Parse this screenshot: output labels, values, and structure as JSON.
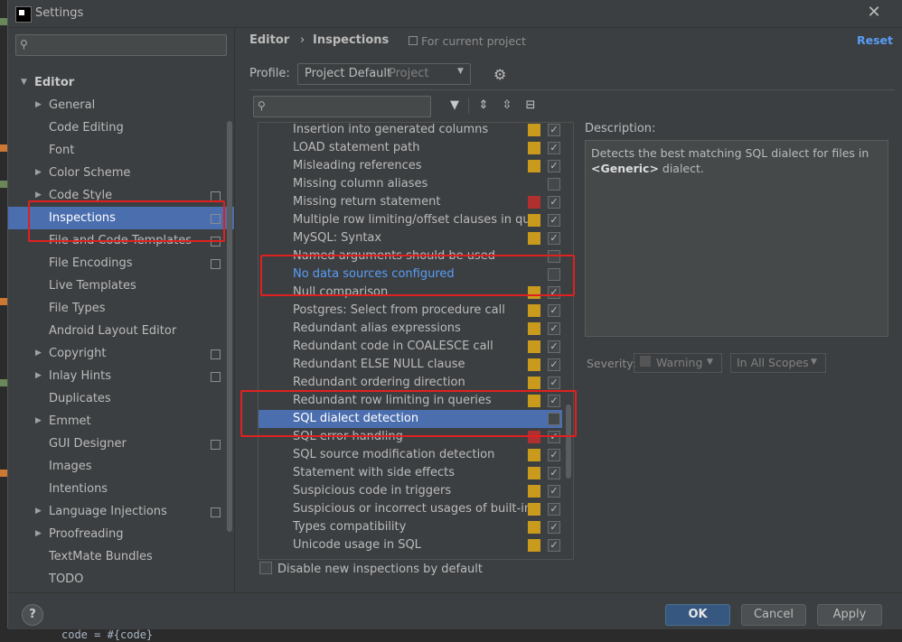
{
  "window": {
    "title": "Settings"
  },
  "left_tree": {
    "items": [
      {
        "label": "Editor",
        "arrow": "▼",
        "root": true
      },
      {
        "label": "General",
        "arrow": "▶"
      },
      {
        "label": "Code Editing",
        "arrow": ""
      },
      {
        "label": "Font",
        "arrow": ""
      },
      {
        "label": "Color Scheme",
        "arrow": "▶"
      },
      {
        "label": "Code Style",
        "arrow": "▶",
        "copy": true
      },
      {
        "label": "Inspections",
        "arrow": "",
        "copy": true,
        "selected": true
      },
      {
        "label": "File and Code Templates",
        "arrow": "",
        "copy": true
      },
      {
        "label": "File Encodings",
        "arrow": "",
        "copy": true
      },
      {
        "label": "Live Templates",
        "arrow": ""
      },
      {
        "label": "File Types",
        "arrow": ""
      },
      {
        "label": "Android Layout Editor",
        "arrow": ""
      },
      {
        "label": "Copyright",
        "arrow": "▶",
        "copy": true
      },
      {
        "label": "Inlay Hints",
        "arrow": "▶",
        "copy": true
      },
      {
        "label": "Duplicates",
        "arrow": ""
      },
      {
        "label": "Emmet",
        "arrow": "▶"
      },
      {
        "label": "GUI Designer",
        "arrow": "",
        "copy": true
      },
      {
        "label": "Images",
        "arrow": ""
      },
      {
        "label": "Intentions",
        "arrow": ""
      },
      {
        "label": "Language Injections",
        "arrow": "▶",
        "copy": true
      },
      {
        "label": "Proofreading",
        "arrow": "▶"
      },
      {
        "label": "TextMate Bundles",
        "arrow": ""
      },
      {
        "label": "TODO",
        "arrow": ""
      }
    ]
  },
  "breadcrumb": {
    "parent": "Editor",
    "current": "Inspections",
    "scope_note": "For current project",
    "reset_label": "Reset"
  },
  "profile": {
    "label": "Profile:",
    "value": "Project Default",
    "scope": "Project"
  },
  "inspections": [
    {
      "name": "Insertion into generated columns",
      "severity": "#c99a1c",
      "checked": true
    },
    {
      "name": "LOAD statement path",
      "severity": "#c99a1c",
      "checked": true
    },
    {
      "name": "Misleading references",
      "severity": "#c99a1c",
      "checked": true
    },
    {
      "name": "Missing column aliases",
      "severity": "",
      "checked": false
    },
    {
      "name": "Missing return statement",
      "severity": "#b03030",
      "checked": true
    },
    {
      "name": "Multiple row limiting/offset clauses in queries",
      "severity": "#c99a1c",
      "checked": true
    },
    {
      "name": "MySQL: Syntax",
      "severity": "#c99a1c",
      "checked": true
    },
    {
      "name": "Named arguments should be used",
      "severity": "",
      "checked": false
    },
    {
      "name": "No data sources configured",
      "severity": "",
      "checked": false,
      "link": true
    },
    {
      "name": "Null comparison",
      "severity": "#c99a1c",
      "checked": true
    },
    {
      "name": "Postgres: Select from procedure call",
      "severity": "#c99a1c",
      "checked": true
    },
    {
      "name": "Redundant alias expressions",
      "severity": "#c99a1c",
      "checked": true
    },
    {
      "name": "Redundant code in COALESCE call",
      "severity": "#c99a1c",
      "checked": true
    },
    {
      "name": "Redundant ELSE NULL clause",
      "severity": "#c99a1c",
      "checked": true
    },
    {
      "name": "Redundant ordering direction",
      "severity": "#c99a1c",
      "checked": true
    },
    {
      "name": "Redundant row limiting in queries",
      "severity": "#c99a1c",
      "checked": true
    },
    {
      "name": "SQL dialect detection",
      "severity": "",
      "checked": false,
      "selected": true
    },
    {
      "name": "SQL error handling",
      "severity": "#b03030",
      "checked": true
    },
    {
      "name": "SQL source modification detection",
      "severity": "#c99a1c",
      "checked": true
    },
    {
      "name": "Statement with side effects",
      "severity": "#c99a1c",
      "checked": true
    },
    {
      "name": "Suspicious code in triggers",
      "severity": "#c99a1c",
      "checked": true
    },
    {
      "name": "Suspicious or incorrect usages of built-in functions",
      "severity": "#c99a1c",
      "checked": true
    },
    {
      "name": "Types compatibility",
      "severity": "#c99a1c",
      "checked": true
    },
    {
      "name": "Unicode usage in SQL",
      "severity": "#c99a1c",
      "checked": true
    }
  ],
  "disable_new": {
    "label": "Disable new inspections by default"
  },
  "description": {
    "label": "Description:",
    "text_before": "Detects the best matching SQL dialect for files in ",
    "bold": "<Generic>",
    "text_after": " dialect."
  },
  "severity": {
    "label": "Severity:",
    "value": "Warning",
    "scope": "In All Scopes"
  },
  "buttons": {
    "help": "?",
    "ok": "OK",
    "cancel": "Cancel",
    "apply": "Apply"
  },
  "editor_peek": {
    "code": "code = #{code}"
  },
  "colors": {
    "accent": "#4b6eaf",
    "link": "#589df6",
    "warning": "#c99a1c",
    "error": "#b03030",
    "annotation": "#e02020"
  }
}
